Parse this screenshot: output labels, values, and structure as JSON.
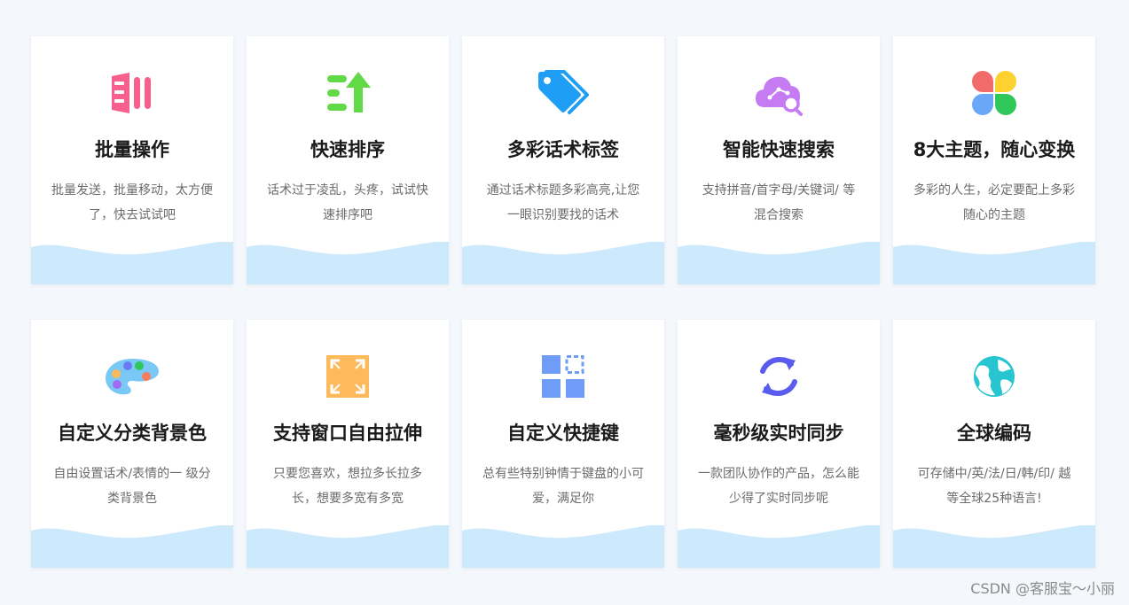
{
  "colors": {
    "page_background": "#f4f7fb",
    "card_background": "#ffffff",
    "wave": "#cdeafd",
    "title": "#1a1a1a",
    "description": "#6b6b6b"
  },
  "features": [
    {
      "icon": "batch-operation-icon",
      "icon_color": "#f75f8e",
      "title": "批量操作",
      "description": "批量发送，批量移动，太方便了，快去试试吧"
    },
    {
      "icon": "sort-up-icon",
      "icon_color": "#62d946",
      "title": "快速排序",
      "description": "话术过于凌乱，头疼，试试快速排序吧"
    },
    {
      "icon": "tag-icon",
      "icon_color": "#1e9ef5",
      "title": "多彩话术标签",
      "description": "通过话术标题多彩高亮,让您一眼识别要找的话术"
    },
    {
      "icon": "cloud-search-icon",
      "icon_color": "#c57cf3",
      "title": "智能快速搜索",
      "description": "支持拼音/首字母/关键词/ 等混合搜索"
    },
    {
      "icon": "four-petal-theme-icon",
      "icon_color": "#fdd12e",
      "title": "8大主题，随心变换",
      "description": "多彩的人生，必定要配上多彩随心的主题"
    },
    {
      "icon": "palette-icon",
      "icon_color": "#79c8f6",
      "title": "自定义分类背景色",
      "description": "自由设置话术/表情的一 级分类背景色"
    },
    {
      "icon": "stretch-window-icon",
      "icon_color": "#fdb95a",
      "title": "支持窗口自由拉伸",
      "description": "只要您喜欢，想拉多长拉多长，想要多宽有多宽"
    },
    {
      "icon": "shortcut-grid-icon",
      "icon_color": "#6f9cf7",
      "title": "自定义快捷键",
      "description": "总有些特别钟情于键盘的小可爱，满足你"
    },
    {
      "icon": "sync-icon",
      "icon_color": "#5a5cf0",
      "title": "毫秒级实时同步",
      "description": "一款团队协作的产品，怎么能少得了实时同步呢"
    },
    {
      "icon": "globe-icon",
      "icon_color": "#27c5cf",
      "title": "全球编码",
      "description": "可存储中/英/法/日/韩/印/ 越等全球25种语言!"
    }
  ],
  "watermark": "CSDN @客服宝～小丽"
}
